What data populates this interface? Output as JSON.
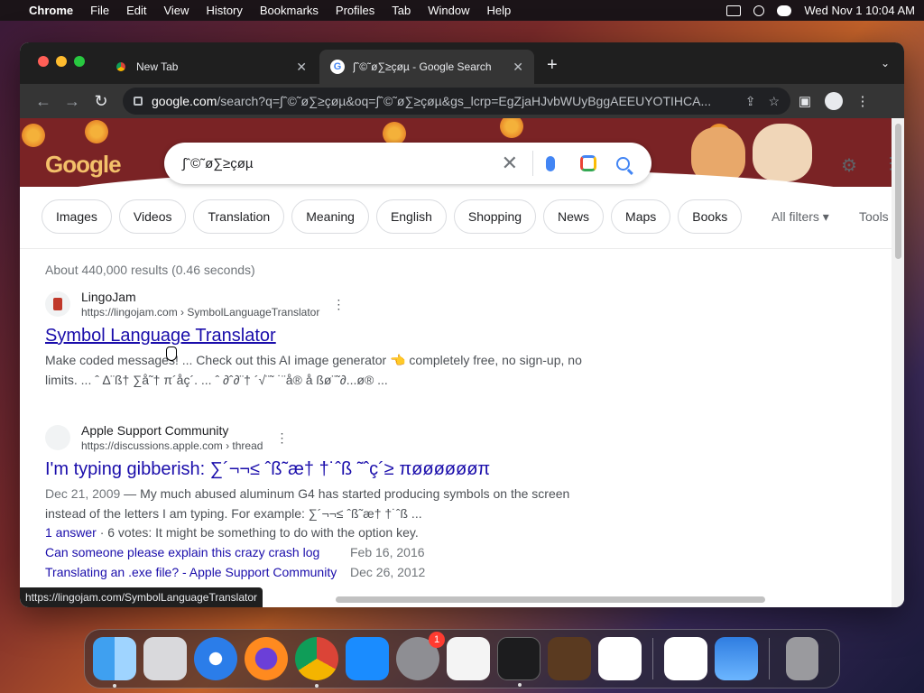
{
  "menubar": {
    "app": "Chrome",
    "items": [
      "File",
      "Edit",
      "View",
      "History",
      "Bookmarks",
      "Profiles",
      "Tab",
      "Window",
      "Help"
    ],
    "clock": "Wed Nov 1  10:04 AM"
  },
  "tabs": [
    {
      "title": "New Tab",
      "active": false
    },
    {
      "title": "∫ˆ©˜ø∑≥çøµ - Google Search",
      "active": true
    }
  ],
  "omnibox": {
    "host": "google.com",
    "path": "/search?q=∫ˆ©˜ø∑≥çøµ&oq=∫ˆ©˜ø∑≥çøµ&gs_lcrp=EgZjaHJvbWUyBggAEEUYOTIHCA..."
  },
  "search": {
    "query": "∫ˆ©˜ø∑≥çøµ",
    "logo": "Google"
  },
  "chips": [
    "Images",
    "Videos",
    "Translation",
    "Meaning",
    "English",
    "Shopping",
    "News",
    "Maps",
    "Books"
  ],
  "filters": {
    "all_filters": "All filters",
    "tools": "Tools"
  },
  "stats": "About 440,000 results (0.46 seconds)",
  "results": [
    {
      "site": "LingoJam",
      "crumb": "https://lingojam.com › SymbolLanguageTranslator",
      "title": "Symbol Language Translator",
      "snippet": "Make coded messages! ... Check out this AI image generator 👈 completely free, no sign-up, no limits. ... ˆ ∆¨ß† ∑å˜† π´åç´. ... ˆ ∂ˆ∂¨† ´√¨˜ ˙¨å® å ßø¨˜∂...ø® ..."
    },
    {
      "site": "Apple Support Community",
      "crumb": "https://discussions.apple.com › thread",
      "title": "I'm typing gibberish: ∑´¬¬≤ ˆß˜æ† †˙ˆß ˜ˆç´≥ πøøøøøøπ",
      "date": "Dec 21, 2009",
      "snippet": " — My much abused aluminum G4 has started producing symbols on the screen instead of the letters I am typing. For example: ∑´¬¬≤ ˆß˜æ† †˙ˆß ...",
      "answer_link": "1 answer",
      "votes": " · 6 votes: ",
      "answer_text": "It might be something to do with the option key.",
      "sublinks": [
        {
          "title": "Can someone please explain this crazy crash log",
          "date": "Feb 16, 2016"
        },
        {
          "title": "Translating an .exe file? - Apple Support Community",
          "date": "Dec 26, 2012"
        }
      ]
    }
  ],
  "status_url": "https://lingojam.com/SymbolLanguageTranslator",
  "dock": {
    "system_settings_badge": "1",
    "apps": [
      "finder-icon",
      "launchpad-icon",
      "safari-icon",
      "firefox-icon",
      "chrome-icon",
      "app-store-icon",
      "system-settings-icon",
      "textedit-icon",
      "terminal-icon",
      "garageband-icon",
      "vscode-icon",
      "visual-studio-icon",
      "weather-icon",
      "trash-icon"
    ]
  }
}
